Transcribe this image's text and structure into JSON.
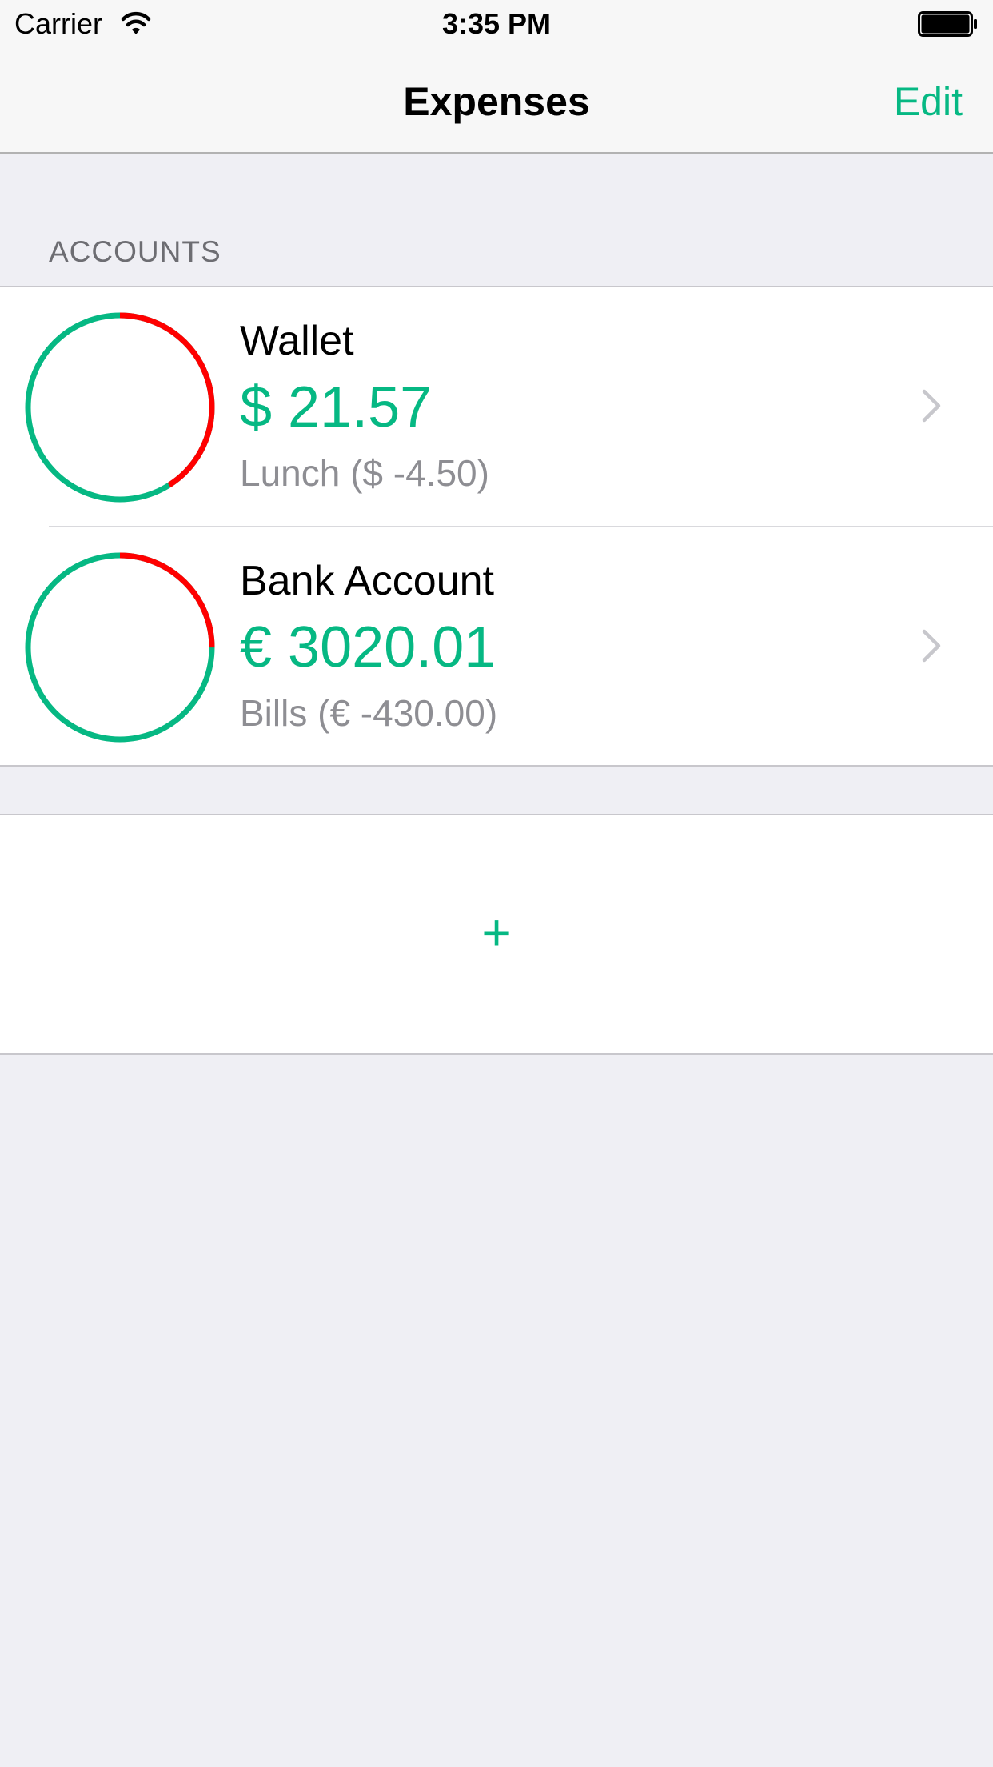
{
  "status_bar": {
    "carrier": "Carrier",
    "time": "3:35 PM",
    "icons": [
      "wifi-icon",
      "battery-icon"
    ]
  },
  "nav": {
    "title": "Expenses",
    "edit_label": "Edit"
  },
  "section": {
    "header": "ACCOUNTS"
  },
  "accounts": [
    {
      "name": "Wallet",
      "balance": "$ 21.57",
      "last_transaction": "Lunch ($ -4.50)",
      "ring": {
        "spent_fraction": 0.41
      }
    },
    {
      "name": "Bank Account",
      "balance": "€ 3020.01",
      "last_transaction": "Bills (€ -430.00)",
      "ring": {
        "spent_fraction": 0.25
      }
    }
  ],
  "add_button": {
    "label": "+"
  },
  "colors": {
    "accent": "#06b883",
    "spent": "#ff0000",
    "secondary_text": "#8e8e93",
    "background": "#efeff4"
  }
}
